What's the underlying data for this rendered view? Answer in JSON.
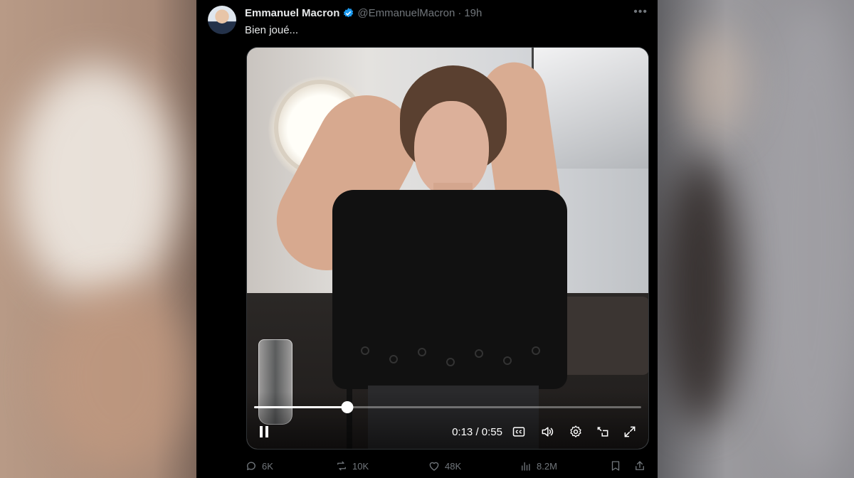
{
  "tweet": {
    "author_name": "Emmanuel Macron",
    "handle": "@EmmanuelMacron",
    "separator": "·",
    "time": "19h",
    "text": "Bien joué...",
    "more_label": "•••"
  },
  "video": {
    "current_time": "0:13",
    "time_separator": " / ",
    "duration": "0:55",
    "progress_fraction": 0.24,
    "icons": [
      "pause-icon",
      "captions-icon",
      "volume-icon",
      "settings-icon",
      "picture-in-picture-icon",
      "fullscreen-icon"
    ]
  },
  "actions": {
    "replies": "6K",
    "reposts": "10K",
    "likes": "48K",
    "views": "8.2M"
  },
  "colors": {
    "background": "#000000",
    "text_primary": "#e7e9ea",
    "text_secondary": "#71767b",
    "verified": "#1d9bf0"
  }
}
